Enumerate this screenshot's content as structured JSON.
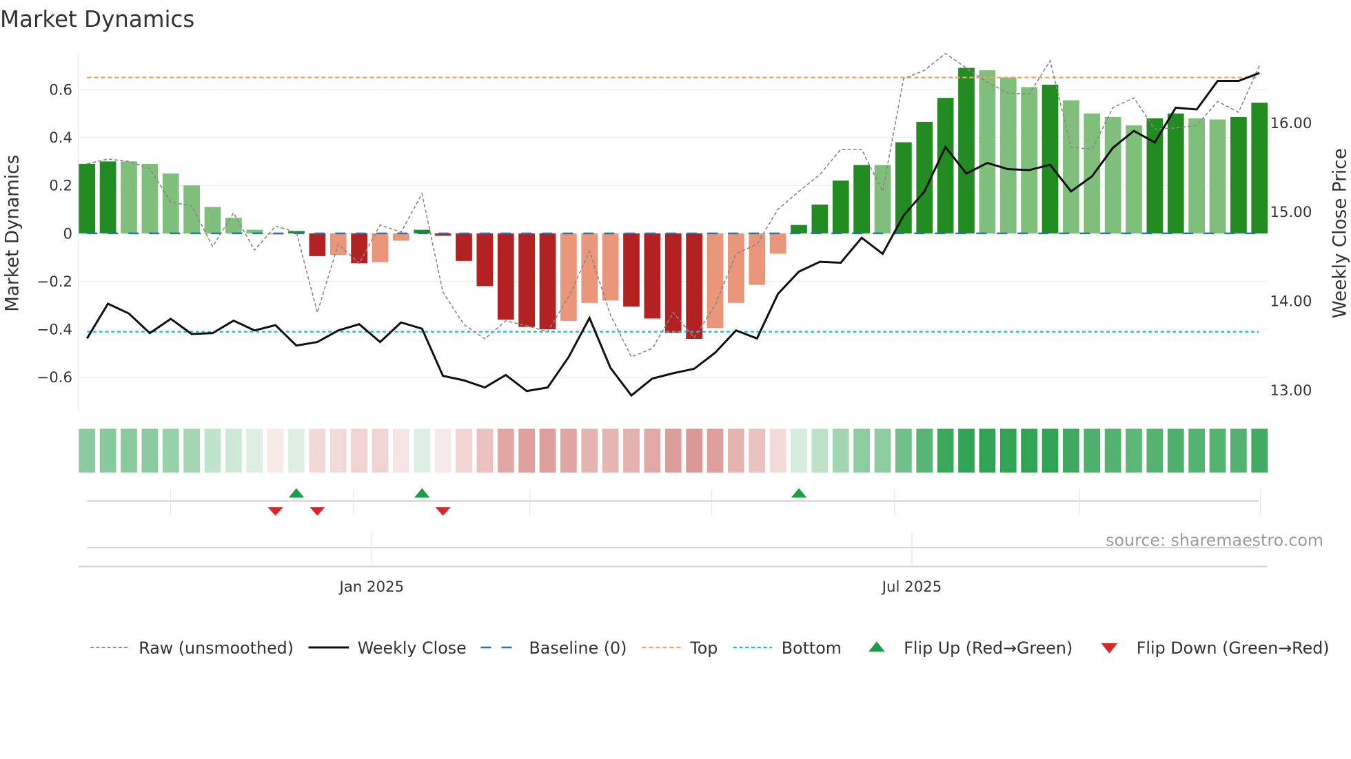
{
  "chart_data": {
    "type": "bar",
    "title": "Market Dynamics",
    "ylabel": "Market Dynamics",
    "y2label": "Weekly Close Price",
    "ylim": [
      -0.743,
      0.747
    ],
    "y2lim": [
      12.76,
      16.77
    ],
    "yticks": [
      "0.6",
      "0.4",
      "0.2",
      "0",
      "−0.2",
      "−0.4",
      "−0.6"
    ],
    "ytick_values": [
      0.6,
      0.4,
      0.2,
      0,
      -0.2,
      -0.4,
      -0.6
    ],
    "y2ticks": [
      "16.00",
      "15.00",
      "14.00",
      "13.00"
    ],
    "y2tick_values": [
      16,
      15,
      14,
      13
    ],
    "xticks": [
      {
        "label": "Jan 2025",
        "index": 13.6
      },
      {
        "label": "Jul 2025",
        "index": 39.4
      }
    ],
    "top_level": 0.65,
    "bottom_level": -0.41,
    "baseline": 0,
    "bars": [
      0.29,
      0.3,
      0.3,
      0.29,
      0.25,
      0.2,
      0.11,
      0.065,
      0.015,
      -0.005,
      0.01,
      -0.095,
      -0.09,
      -0.125,
      -0.12,
      -0.03,
      0.015,
      -0.01,
      -0.115,
      -0.22,
      -0.36,
      -0.39,
      -0.4,
      -0.365,
      -0.29,
      -0.28,
      -0.305,
      -0.355,
      -0.415,
      -0.44,
      -0.395,
      -0.29,
      -0.215,
      -0.085,
      0.035,
      0.12,
      0.22,
      0.285,
      0.285,
      0.38,
      0.465,
      0.565,
      0.69,
      0.68,
      0.65,
      0.61,
      0.62,
      0.555,
      0.5,
      0.485,
      0.45,
      0.48,
      0.5,
      0.48,
      0.475,
      0.485,
      0.545
    ],
    "bar_shade": [
      "d",
      "d",
      "l",
      "l",
      "l",
      "l",
      "l",
      "l",
      "l",
      "l",
      "d",
      "d",
      "l",
      "d",
      "l",
      "l",
      "d",
      "d",
      "d",
      "d",
      "d",
      "d",
      "d",
      "l",
      "l",
      "l",
      "d",
      "d",
      "d",
      "d",
      "l",
      "l",
      "l",
      "l",
      "d",
      "d",
      "d",
      "d",
      "l",
      "d",
      "d",
      "d",
      "d",
      "l",
      "l",
      "l",
      "d",
      "l",
      "l",
      "l",
      "l",
      "d",
      "d",
      "l",
      "l",
      "d",
      "d"
    ],
    "raw": [
      0.29,
      0.31,
      0.3,
      0.27,
      0.13,
      0.115,
      -0.055,
      0.085,
      -0.07,
      0.03,
      0.005,
      -0.33,
      -0.045,
      -0.125,
      0.035,
      0.005,
      0.165,
      -0.245,
      -0.38,
      -0.44,
      -0.365,
      -0.385,
      -0.41,
      -0.265,
      -0.075,
      -0.34,
      -0.515,
      -0.48,
      -0.33,
      -0.435,
      -0.3,
      -0.085,
      -0.045,
      0.1,
      0.175,
      0.245,
      0.35,
      0.35,
      0.175,
      0.645,
      0.68,
      0.75,
      0.69,
      0.63,
      0.585,
      0.58,
      0.72,
      0.36,
      0.35,
      0.525,
      0.565,
      0.435,
      0.44,
      0.45,
      0.55,
      0.505,
      0.7
    ],
    "close": [
      13.58,
      13.97,
      13.86,
      13.64,
      13.8,
      13.63,
      13.64,
      13.78,
      13.67,
      13.73,
      13.5,
      13.54,
      13.67,
      13.74,
      13.54,
      13.76,
      13.69,
      13.16,
      13.11,
      13.03,
      13.17,
      12.99,
      13.03,
      13.37,
      13.81,
      13.25,
      12.94,
      13.13,
      13.19,
      13.24,
      13.42,
      13.67,
      13.58,
      14.08,
      14.33,
      14.44,
      14.43,
      14.71,
      14.53,
      14.96,
      15.23,
      15.73,
      15.43,
      15.55,
      15.48,
      15.47,
      15.53,
      15.23,
      15.4,
      15.72,
      15.91,
      15.78,
      16.17,
      16.15,
      16.47,
      16.47,
      16.56
    ],
    "flip_up": [
      10,
      16,
      34
    ],
    "flip_down": [
      9,
      11,
      17
    ],
    "legend": [
      "Raw (unsmoothed)",
      "Weekly Close",
      "Baseline (0)",
      "Top",
      "Bottom",
      "Flip Up (Red→Green)",
      "Flip Down (Green→Red)"
    ],
    "legend_placement": "bottom",
    "colors": {
      "dark_green": "#228b22",
      "light_green": "#7fbf7b",
      "dark_red": "#b22222",
      "light_red": "#e9967a",
      "top": "#f4a460",
      "bottom": "#17becf",
      "baseline": "#1f77b4",
      "up": "#1a9e48",
      "down": "#d62728"
    }
  },
  "source": "source: sharemaestro.com"
}
